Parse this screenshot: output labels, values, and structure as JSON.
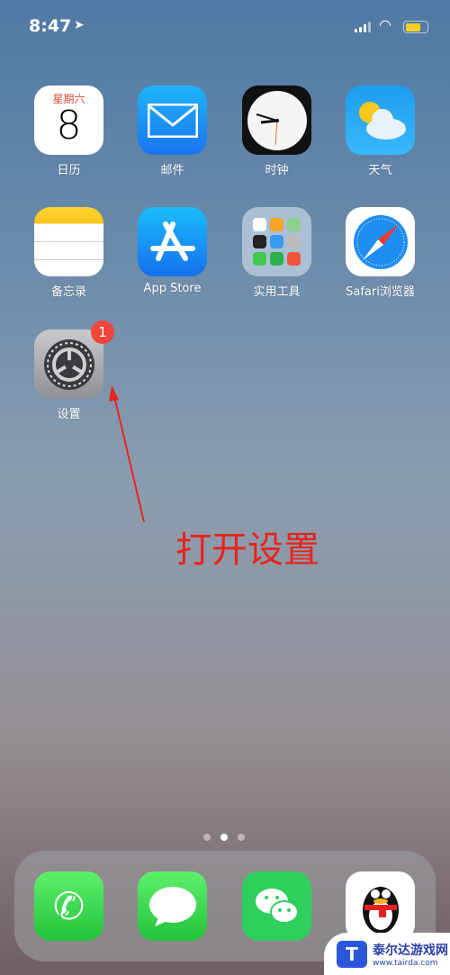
{
  "status": {
    "time": "8:47",
    "battery_level": 0.7
  },
  "apps": [
    {
      "label": "日历",
      "icon": "calendar-icon",
      "weekday": "星期六",
      "day": "8"
    },
    {
      "label": "邮件",
      "icon": "mail-icon"
    },
    {
      "label": "时钟",
      "icon": "clock-icon"
    },
    {
      "label": "天气",
      "icon": "weather-icon"
    },
    {
      "label": "备忘录",
      "icon": "notes-icon"
    },
    {
      "label": "App Store",
      "icon": "app-store-icon"
    },
    {
      "label": "实用工具",
      "icon": "folder-icon"
    },
    {
      "label": "Safari浏览器",
      "icon": "safari-icon"
    },
    {
      "label": "设置",
      "icon": "settings-gear-icon",
      "badge": "1"
    }
  ],
  "page_indicator": {
    "pages": 3,
    "current": 2
  },
  "dock": [
    {
      "icon": "phone-icon"
    },
    {
      "icon": "messages-icon"
    },
    {
      "icon": "wechat-icon"
    },
    {
      "icon": "qq-penguin-icon"
    }
  ],
  "annotation": "打开设置",
  "watermark": {
    "name": "泰尔达游戏网",
    "url": "www.tairda.com"
  },
  "colors": {
    "annotation": "#e8241c",
    "badge": "#f0453a"
  }
}
